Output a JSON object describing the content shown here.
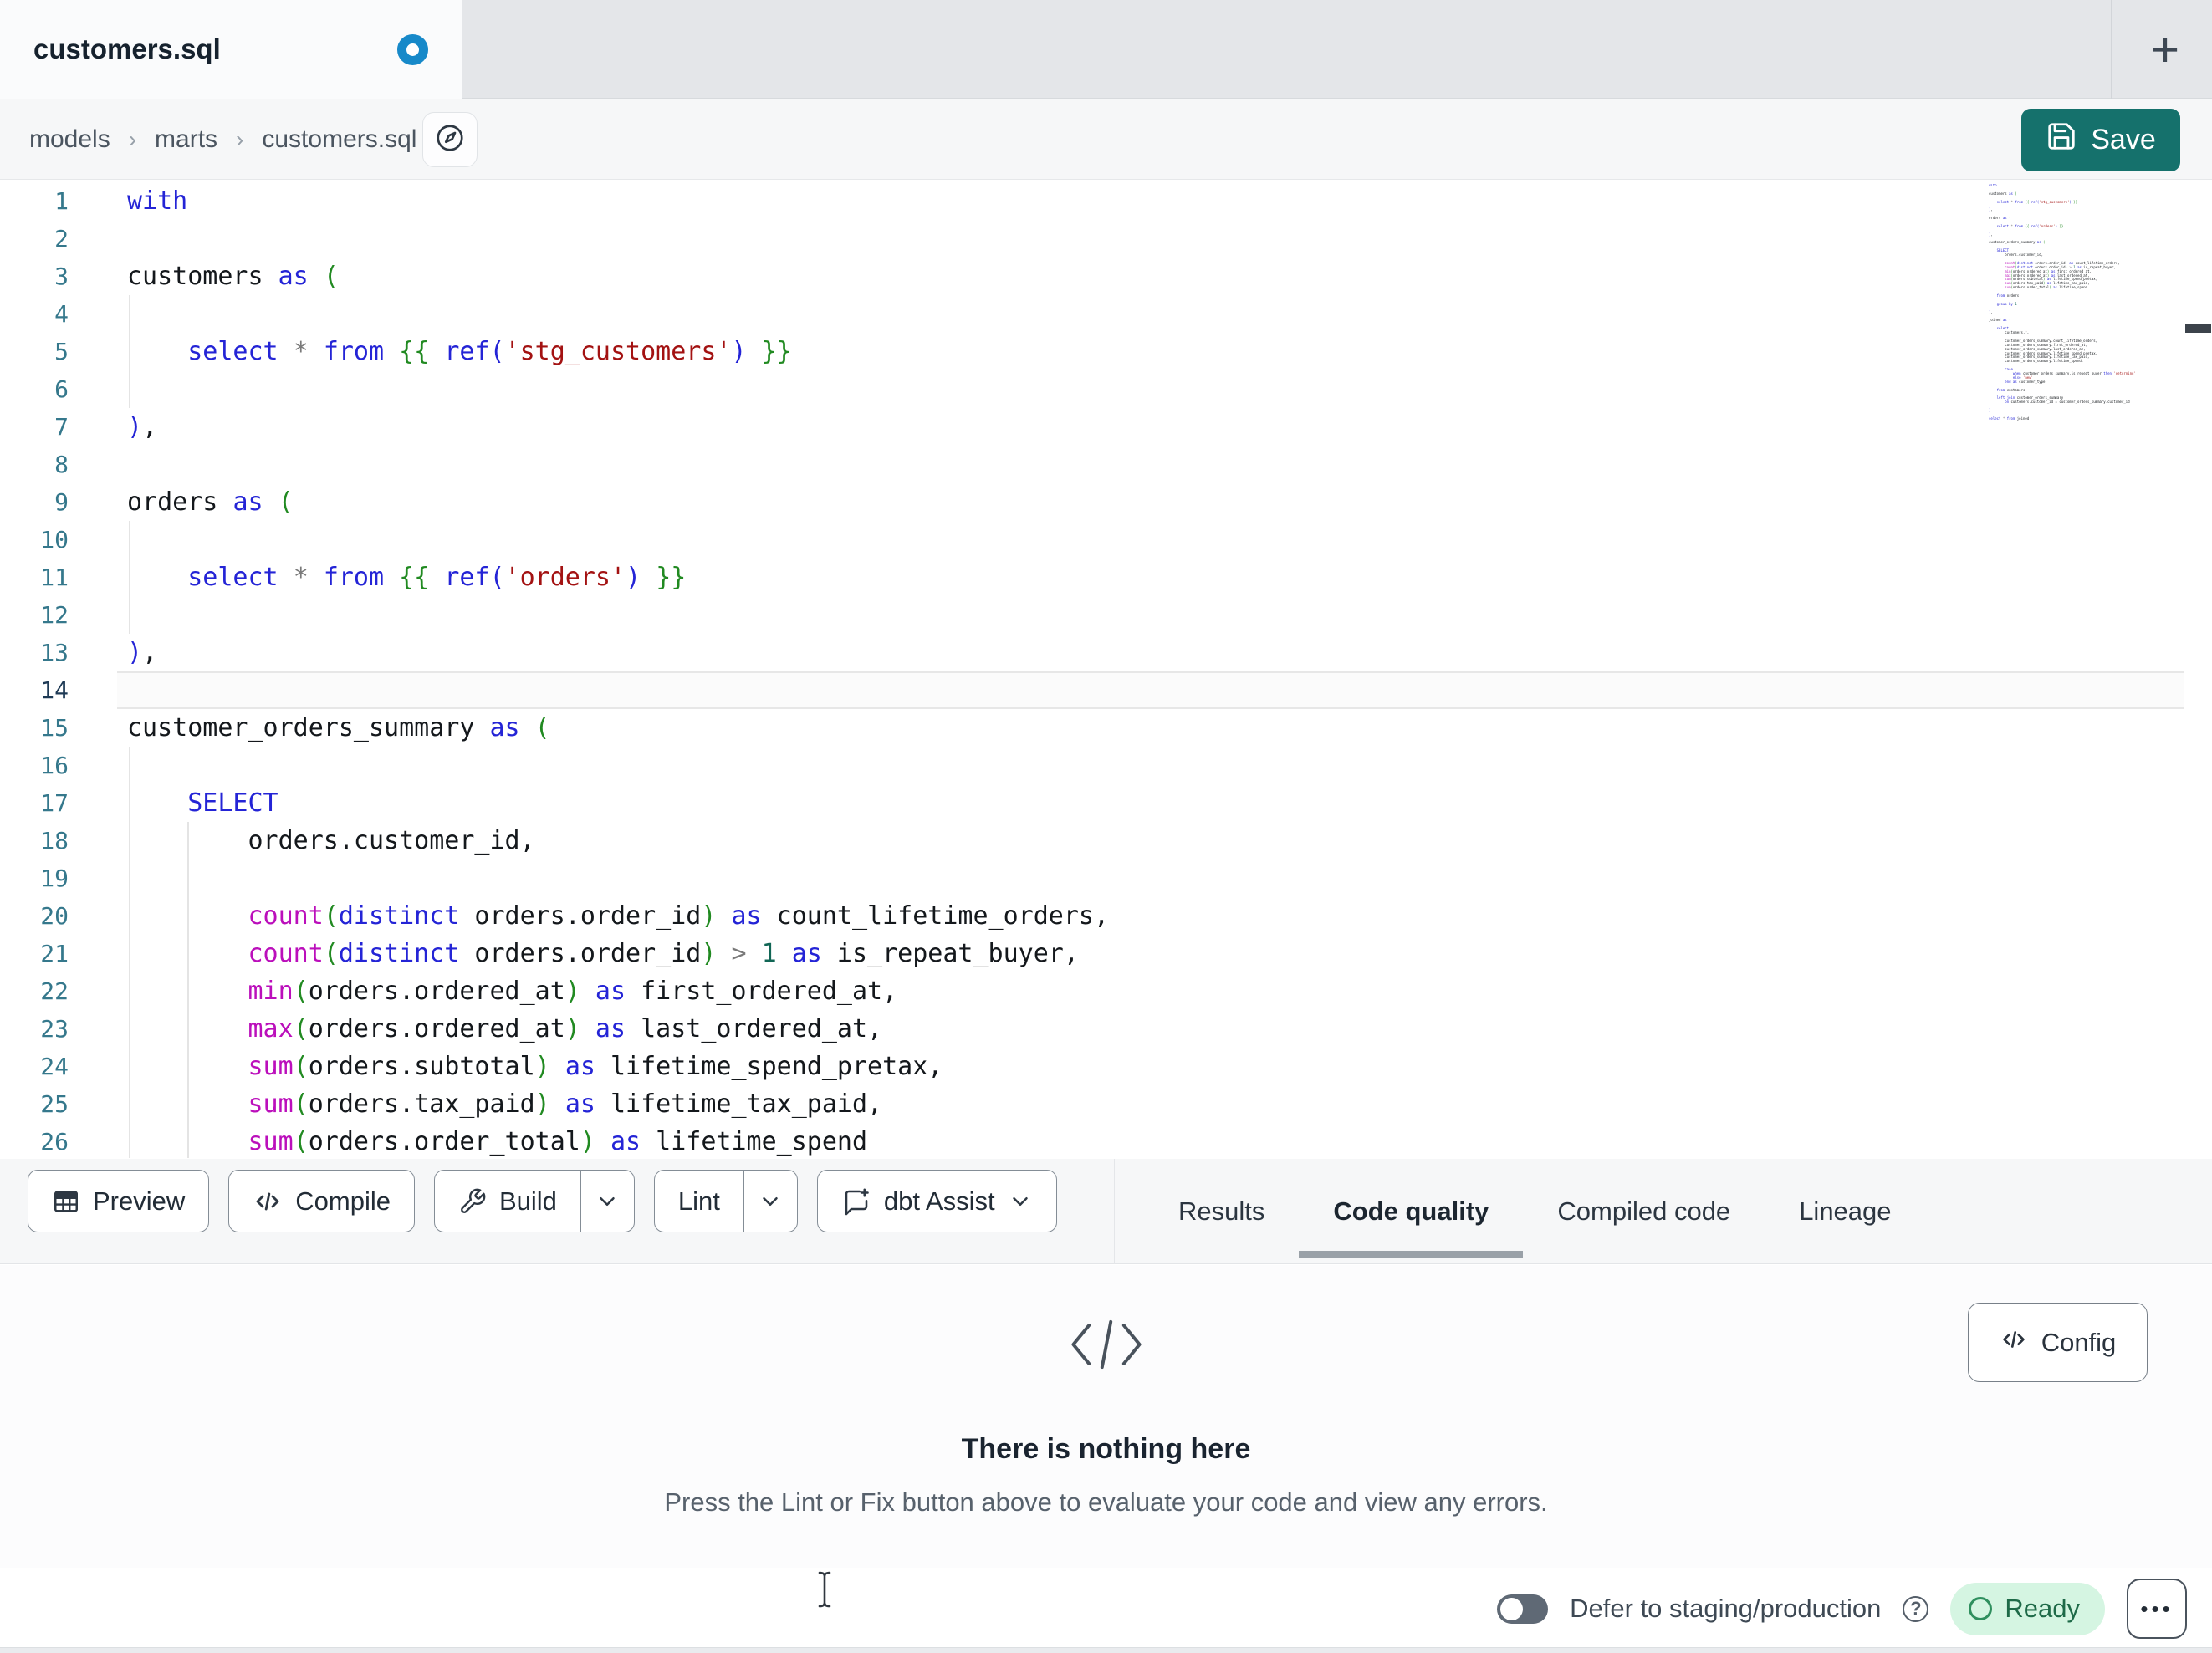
{
  "window": {
    "tab_title": "customers.sql",
    "tab_modified": true,
    "new_tab_label": "+"
  },
  "breadcrumb": {
    "items": [
      "models",
      "marts",
      "customers.sql"
    ],
    "separator": "›"
  },
  "header": {
    "save_label": "Save"
  },
  "editor": {
    "active_line": 14,
    "lines": [
      "with",
      "",
      "customers as (",
      "",
      "    select * from {{ ref('stg_customers') }}",
      "",
      "),",
      "",
      "orders as (",
      "",
      "    select * from {{ ref('orders') }}",
      "",
      "),",
      "",
      "customer_orders_summary as (",
      "",
      "    SELECT",
      "        orders.customer_id,",
      "",
      "        count(distinct orders.order_id) as count_lifetime_orders,",
      "        count(distinct orders.order_id) > 1 as is_repeat_buyer,",
      "        min(orders.ordered_at) as first_ordered_at,",
      "        max(orders.ordered_at) as last_ordered_at,",
      "        sum(orders.subtotal) as lifetime_spend_pretax,",
      "        sum(orders.tax_paid) as lifetime_tax_paid,",
      "        sum(orders.order_total) as lifetime_spend"
    ],
    "minimap_lines": [
      "with",
      "",
      "customers as (",
      "",
      "    select * from {{ ref('stg_customers') }}",
      "",
      "),",
      "",
      "orders as (",
      "",
      "    select * from {{ ref('orders') }}",
      "",
      "),",
      "",
      "customer_orders_summary as (",
      "",
      "    SELECT",
      "        orders.customer_id,",
      "",
      "        count(distinct orders.order_id) as count_lifetime_orders,",
      "        count(distinct orders.order_id) > 1 as is_repeat_buyer,",
      "        min(orders.ordered_at) as first_ordered_at,",
      "        max(orders.ordered_at) as last_ordered_at,",
      "        sum(orders.subtotal) as lifetime_spend_pretax,",
      "        sum(orders.tax_paid) as lifetime_tax_paid,",
      "        sum(orders.order_total) as lifetime_spend",
      "",
      "    from orders",
      "",
      "    group by 1",
      "",
      "),",
      "",
      "joined as (",
      "",
      "    select",
      "        customers.*,",
      "",
      "        customer_orders_summary.count_lifetime_orders,",
      "        customer_orders_summary.first_ordered_at,",
      "        customer_orders_summary.last_ordered_at,",
      "        customer_orders_summary.lifetime_spend_pretax,",
      "        customer_orders_summary.lifetime_tax_paid,",
      "        customer_orders_summary.lifetime_spend,",
      "",
      "        case",
      "            when customer_orders_summary.is_repeat_buyer then 'returning'",
      "            else 'new'",
      "        end as customer_type",
      "",
      "    from customers",
      "",
      "    left join customer_orders_summary",
      "        on customers.customer_id = customer_orders_summary.customer_id",
      "",
      ")",
      "",
      "select * from joined"
    ],
    "syntax_colors": {
      "keyword": "#2424d6",
      "function": "#bb0fbb",
      "string": "#a31212",
      "number": "#116655",
      "paren": "#218a21",
      "jinja": "#218a21",
      "operator": "#7a7a7a",
      "text": "#14181c",
      "line_number": "#35788c",
      "active_line_number": "#1e3a55"
    }
  },
  "toolbar": {
    "buttons": [
      {
        "label": "Preview"
      },
      {
        "label": "Compile"
      },
      {
        "label": "Build"
      },
      {
        "label": "Lint"
      },
      {
        "label": "dbt Assist"
      }
    ]
  },
  "result_tabs": {
    "items": [
      "Results",
      "Code quality",
      "Compiled code",
      "Lineage"
    ],
    "active": "Code quality"
  },
  "empty_state": {
    "title": "There is nothing here",
    "subtitle": "Press the Lint or Fix button above to evaluate your code and view any errors.",
    "config_label": "Config"
  },
  "statusbar": {
    "defer_label": "Defer to staging/production",
    "defer_on": false,
    "status_label": "Ready",
    "menu_label": "•••"
  },
  "colors": {
    "accent_teal": "#15716c",
    "modified_dot_blue": "#1789c9",
    "status_green_bg": "#d5f5e2",
    "status_green_text": "#1e6a48",
    "status_green_ring": "#2f8f5e"
  }
}
